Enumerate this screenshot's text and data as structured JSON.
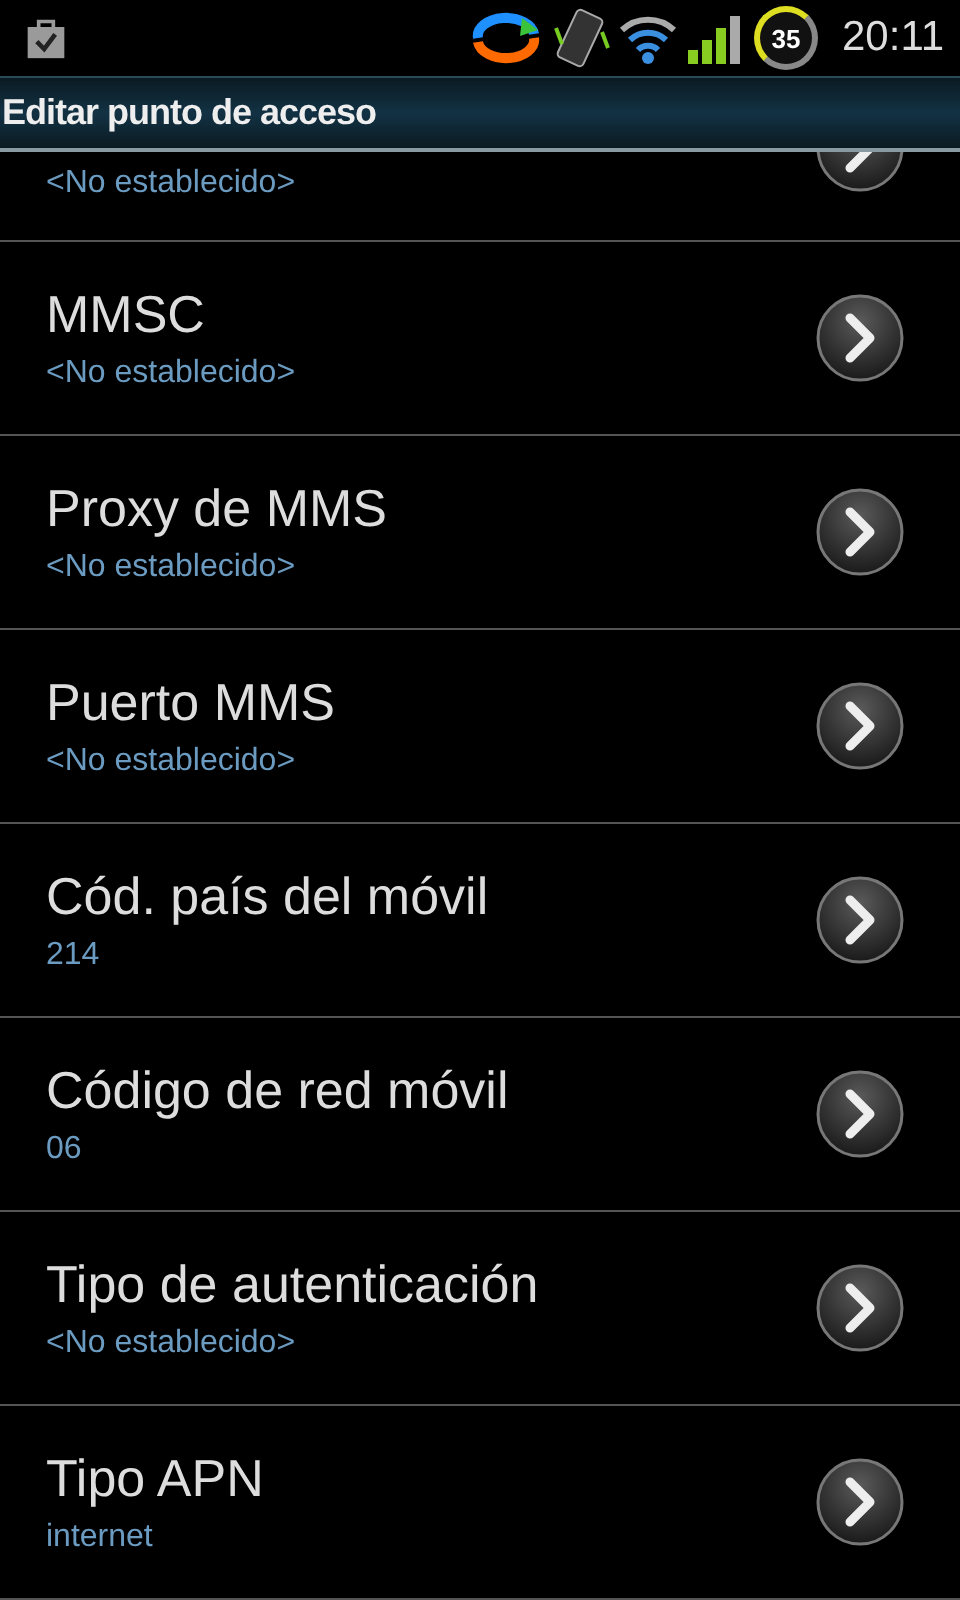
{
  "status_bar": {
    "battery": "35",
    "time": "20:11"
  },
  "title": "Editar punto de acceso",
  "partial_item": {
    "summary": "<No establecido>"
  },
  "items": [
    {
      "title": "MMSC",
      "summary": "<No establecido>"
    },
    {
      "title": "Proxy de MMS",
      "summary": "<No establecido>"
    },
    {
      "title": "Puerto MMS",
      "summary": "<No establecido>"
    },
    {
      "title": "Cód. país del móvil",
      "summary": "214"
    },
    {
      "title": "Código de red móvil",
      "summary": "06"
    },
    {
      "title": "Tipo de autenticación",
      "summary": "<No establecido>"
    },
    {
      "title": "Tipo APN",
      "summary": "internet"
    }
  ]
}
